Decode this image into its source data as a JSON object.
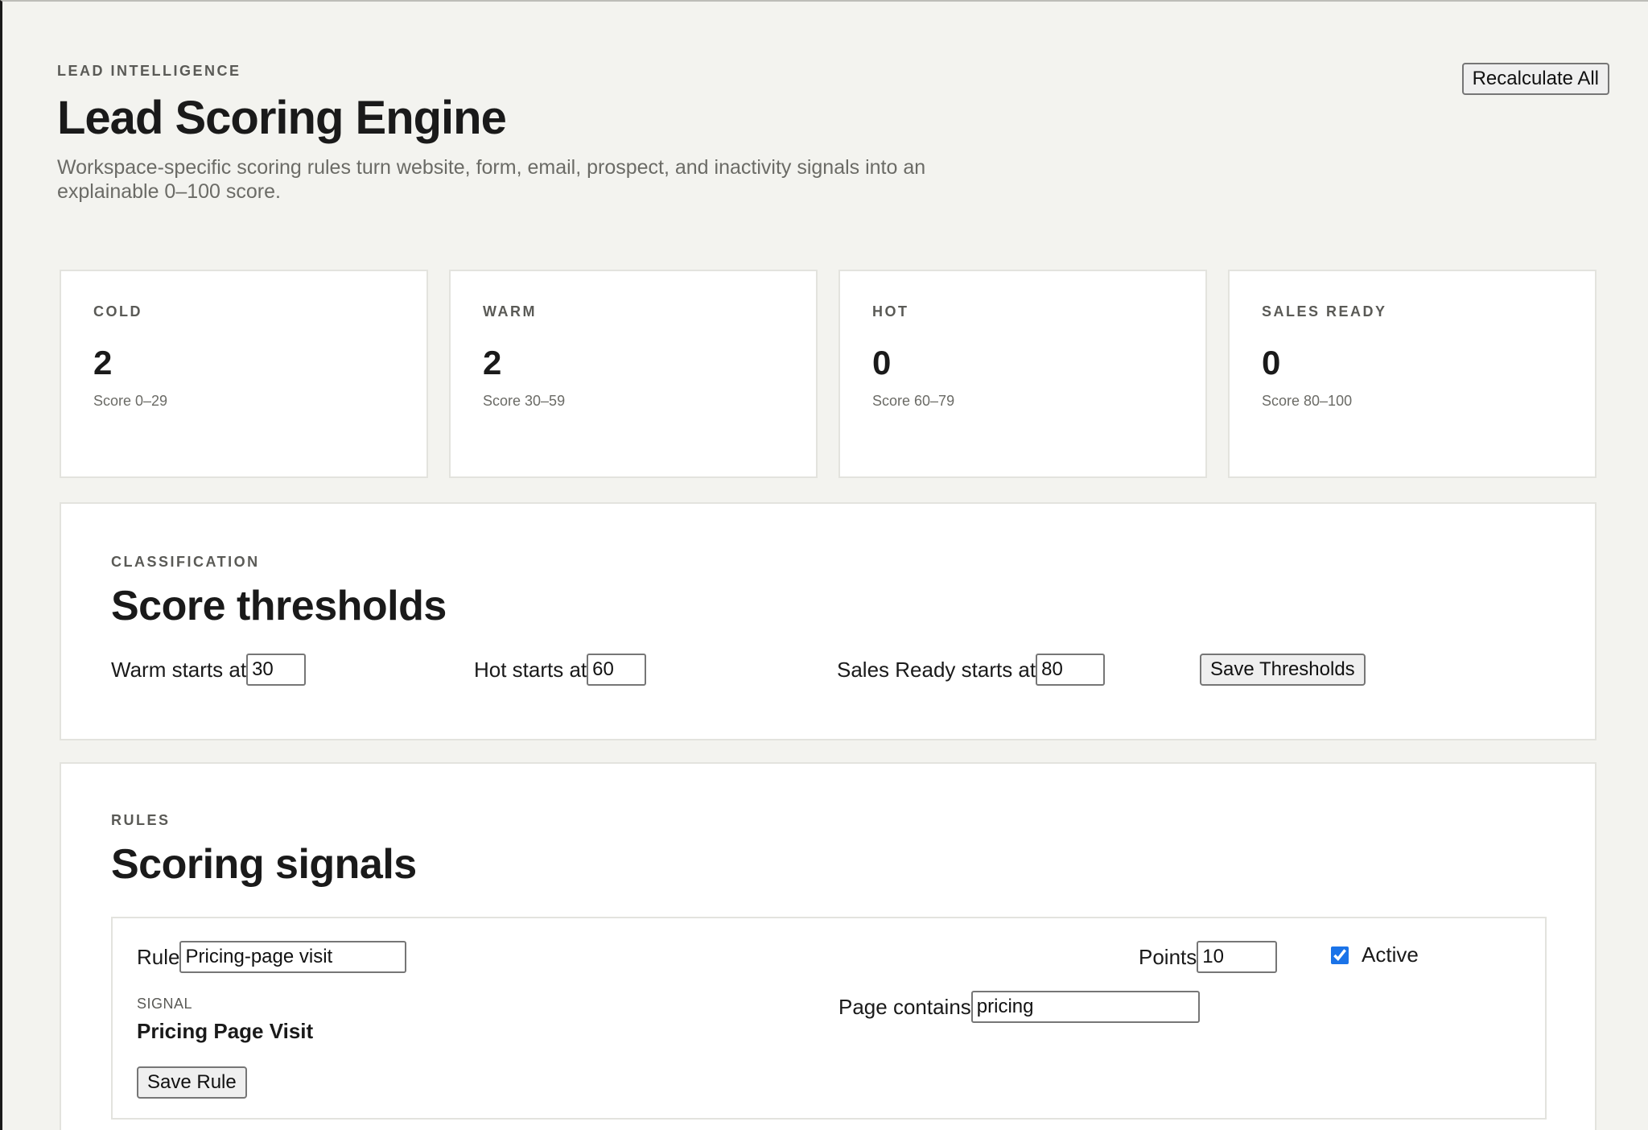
{
  "header": {
    "kicker": "LEAD INTELLIGENCE",
    "title": "Lead Scoring Engine",
    "subtitle": "Workspace-specific scoring rules turn website, form, email, prospect, and inactivity signals into an explainable 0–100 score.",
    "recalculate_label": "Recalculate All"
  },
  "stats": [
    {
      "label": "COLD",
      "count": "2",
      "range": "Score 0–29"
    },
    {
      "label": "WARM",
      "count": "2",
      "range": "Score 30–59"
    },
    {
      "label": "HOT",
      "count": "0",
      "range": "Score 60–79"
    },
    {
      "label": "SALES READY",
      "count": "0",
      "range": "Score 80–100"
    }
  ],
  "thresholds": {
    "kicker": "CLASSIFICATION",
    "title": "Score thresholds",
    "warm_label": "Warm starts at",
    "warm_value": "30",
    "hot_label": "Hot starts at",
    "hot_value": "60",
    "sales_ready_label": "Sales Ready starts at",
    "sales_ready_value": "80",
    "save_label": "Save Thresholds"
  },
  "rules": {
    "kicker": "RULES",
    "title": "Scoring signals",
    "items": [
      {
        "rule_label": "Rule",
        "rule_value": "Pricing-page visit",
        "points_label": "Points",
        "points_value": "10",
        "active_label": "Active",
        "active": true,
        "signal_label": "SIGNAL",
        "signal_value": "Pricing Page Visit",
        "condition_label": "Page contains",
        "condition_value": "pricing",
        "save_label": "Save Rule"
      }
    ]
  }
}
